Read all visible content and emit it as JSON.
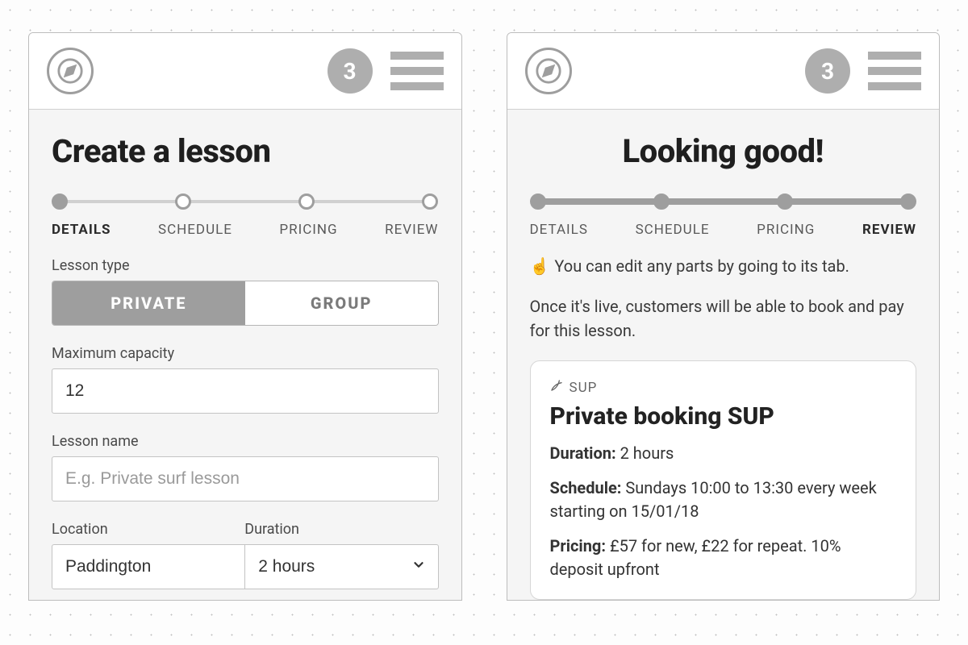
{
  "header": {
    "notif_count": "3"
  },
  "steps": {
    "labels": [
      "DETAILS",
      "SCHEDULE",
      "PRICING",
      "REVIEW"
    ]
  },
  "left": {
    "title": "Create a lesson",
    "active_step_index": 0,
    "labels": {
      "lesson_type": "Lesson type",
      "max_capacity": "Maximum capacity",
      "lesson_name": "Lesson name",
      "location": "Location",
      "duration": "Duration"
    },
    "segmented": {
      "private": "PRIVATE",
      "group": "GROUP",
      "active": "private"
    },
    "fields": {
      "max_capacity_value": "12",
      "lesson_name_placeholder": "E.g. Private surf lesson",
      "location_value": "Paddington",
      "duration_value": "2 hours"
    }
  },
  "right": {
    "title": "Looking good!",
    "active_step_index": 3,
    "hint_emoji": "☝️",
    "hint_text": "You can edit any parts by going to its tab.",
    "live_text": "Once it's live, customers will be able to book and pay for this lesson.",
    "card": {
      "category": "SUP",
      "title": "Private booking SUP",
      "duration_label": "Duration:",
      "duration_value": "2 hours",
      "schedule_label": "Schedule:",
      "schedule_value": "Sundays 10:00 to 13:30 every week starting on 15/01/18",
      "pricing_label": "Pricing:",
      "pricing_value": "£57 for new, £22 for repeat. 10% deposit upfront"
    }
  }
}
